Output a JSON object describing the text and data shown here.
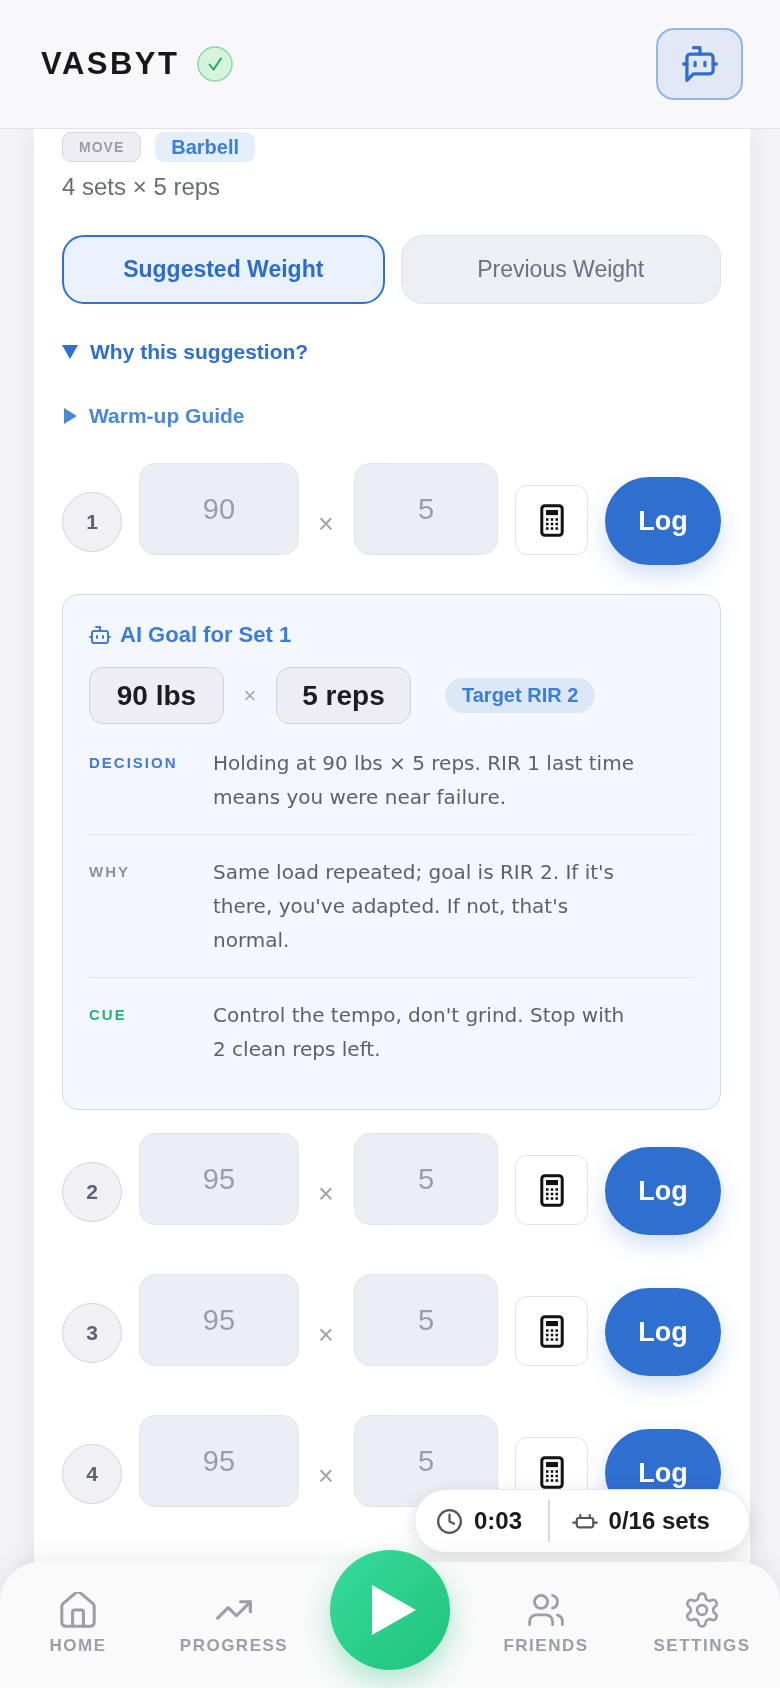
{
  "header": {
    "logo": "VASBYT"
  },
  "exercise": {
    "tags": [
      {
        "label": "MOVE",
        "kind": "category"
      },
      {
        "label": "Barbell",
        "kind": "equipment"
      }
    ],
    "scheme": "4 sets × 5 reps"
  },
  "weight_toggle": [
    {
      "label": "Suggested Weight",
      "selected": true
    },
    {
      "label": "Previous Weight",
      "selected": false
    }
  ],
  "disclosures": [
    {
      "label": "Why this suggestion?",
      "expanded": true
    },
    {
      "label": "Warm-up Guide",
      "expanded": false
    }
  ],
  "sets": [
    {
      "number": "1",
      "weight_field": {
        "placeholder": "90"
      },
      "times": "×",
      "reps_field": {
        "placeholder": "5"
      },
      "log_button": "Log",
      "ai_goal": {
        "title": "AI Goal for Set 1",
        "weight": "90 lbs",
        "times": "×",
        "reps": "5 reps",
        "badge": "Target RIR 2",
        "notes": [
          {
            "kind": "decision",
            "label": "DECISION",
            "text": "Holding at 90 lbs × 5 reps. RIR 1 last time means you were near failure."
          },
          {
            "kind": "why",
            "label": "WHY",
            "text": "Same load repeated; goal is RIR 2. If it's there, you've adapted. If not, that's normal."
          },
          {
            "kind": "cue",
            "label": "CUE",
            "text": "Control the tempo, don't grind. Stop with 2 clean reps left."
          }
        ]
      }
    },
    {
      "number": "2",
      "weight_field": {
        "placeholder": "95"
      },
      "times": "×",
      "reps_field": {
        "placeholder": "5"
      },
      "log_button": "Log"
    },
    {
      "number": "3",
      "weight_field": {
        "placeholder": "95"
      },
      "times": "×",
      "reps_field": {
        "placeholder": "5"
      },
      "log_button": "Log"
    },
    {
      "number": "4",
      "weight_field": {
        "placeholder": "95"
      },
      "times": "×",
      "reps_field": {
        "placeholder": "5"
      },
      "log_button": "Log"
    }
  ],
  "session_pill": {
    "timer": "0:03",
    "sets_count": "0/16 sets"
  },
  "bottom_nav": {
    "items": [
      {
        "kind": "home",
        "label": "HOME",
        "selected": false
      },
      {
        "kind": "progress",
        "label": "PROGRESS",
        "selected": false
      },
      {
        "kind": "start"
      },
      {
        "kind": "friends",
        "label": "FRIENDS",
        "selected": false
      },
      {
        "kind": "settings",
        "label": "SETTINGS",
        "selected": false
      }
    ]
  }
}
